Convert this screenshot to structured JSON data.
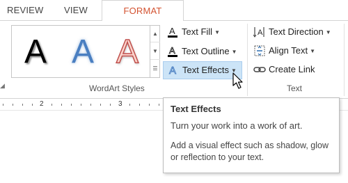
{
  "tabs": {
    "review": "REVIEW",
    "view": "VIEW",
    "format": "FORMAT"
  },
  "wordart": {
    "samples": [
      "A",
      "A",
      "A"
    ],
    "group_label": "WordArt Styles"
  },
  "text_commands": {
    "fill": "Text Fill",
    "outline": "Text Outline",
    "effects": "Text Effects",
    "direction": "Text Direction",
    "align": "Align Text",
    "link": "Create Link",
    "group_label": "Text"
  },
  "ruler": {
    "numbers": [
      "2",
      "3"
    ]
  },
  "tooltip": {
    "title": "Text Effects",
    "line1": "Turn your work into a work of art.",
    "line2": "Add a visual effect such as shadow, glow or reflection to your text."
  },
  "colors": {
    "accent": "#d35230",
    "highlight": "#cce4f7",
    "blue_sample": "#4a7fc1",
    "pink_sample": "#fbd4cc"
  }
}
